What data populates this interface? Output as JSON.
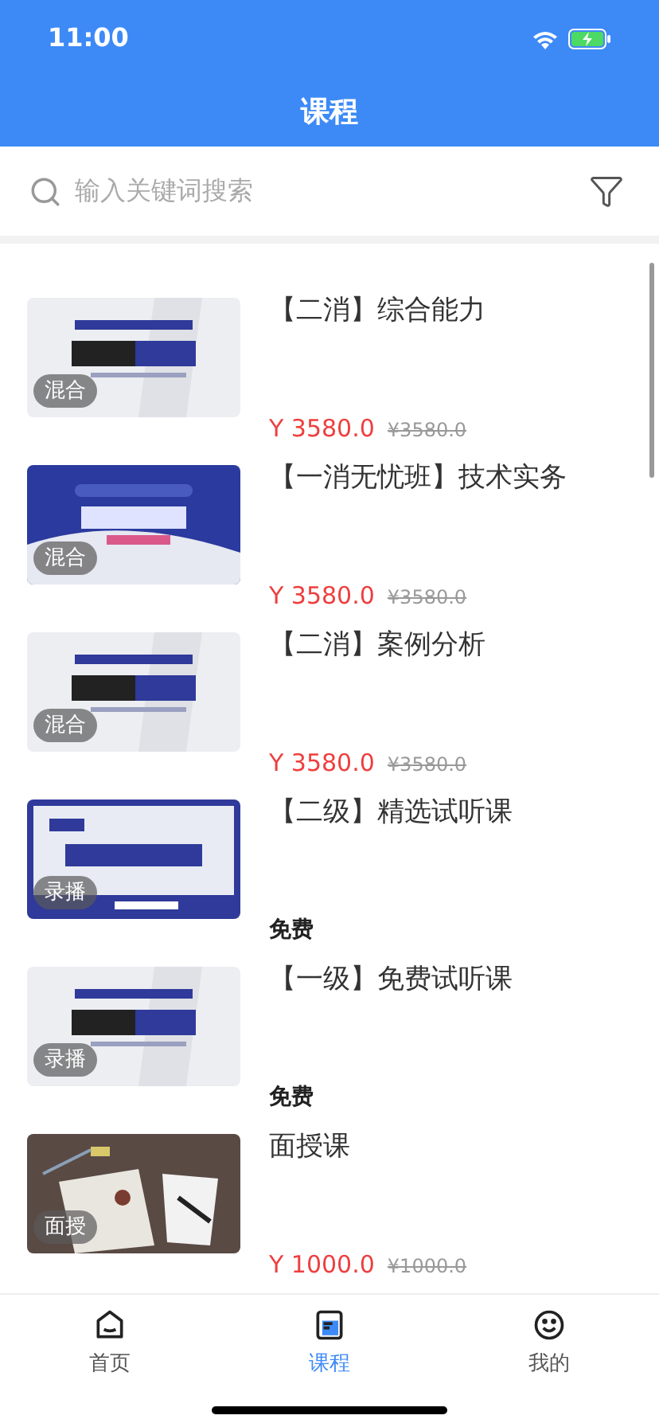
{
  "status_bar": {
    "time": "11:00"
  },
  "header": {
    "title": "课程"
  },
  "search": {
    "placeholder": "输入关键词搜索"
  },
  "courses": [
    {
      "kind": "paid",
      "title": "【二消】综合能力",
      "badge": "混合",
      "price": "Y 3580.0",
      "original_price": "¥3580.0"
    },
    {
      "kind": "paid",
      "title": "【一消无忧班】技术实务",
      "badge": "混合",
      "price": "Y 3580.0",
      "original_price": "¥3580.0"
    },
    {
      "kind": "paid",
      "title": "【二消】案例分析",
      "badge": "混合",
      "price": "Y 3580.0",
      "original_price": "¥3580.0"
    },
    {
      "kind": "free",
      "title": "【二级】精选试听课",
      "badge": "录播",
      "price": "免费"
    },
    {
      "kind": "free",
      "title": "【一级】免费试听课",
      "badge": "录播",
      "price": "免费"
    },
    {
      "kind": "paid",
      "title": "面授课",
      "badge": "面授",
      "price": "Y 1000.0",
      "original_price": "¥1000.0"
    }
  ],
  "tabs": [
    {
      "label": "首页",
      "selected": false
    },
    {
      "label": "课程",
      "selected": true
    },
    {
      "label": "我的",
      "selected": false
    }
  ]
}
